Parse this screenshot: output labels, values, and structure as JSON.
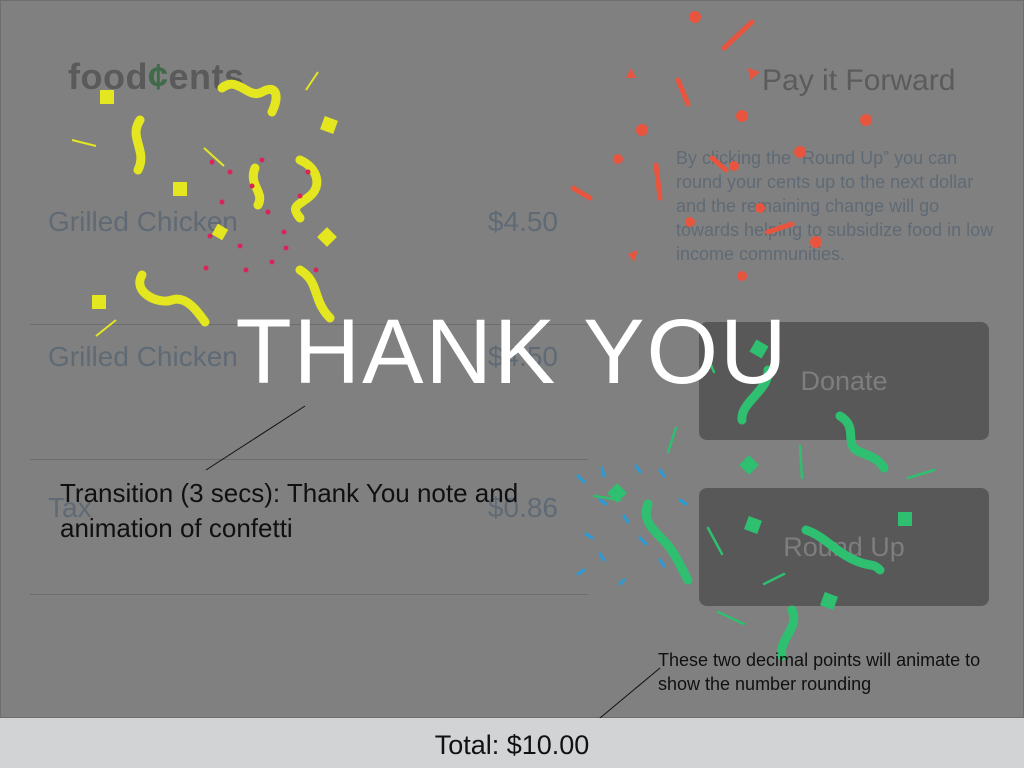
{
  "app": {
    "logo_prefix": "food",
    "logo_cent": "¢",
    "logo_suffix": "ents"
  },
  "order": {
    "items": [
      {
        "name": "Grilled Chicken",
        "price": "$4.50"
      },
      {
        "name": "Grilled Chicken",
        "price": "$4.50"
      }
    ],
    "tax": {
      "name": "Tax",
      "price": "$0.86"
    }
  },
  "pay_forward": {
    "title": "Pay it Forward",
    "description": "By clicking the “Round Up” you can round your cents up to the next dollar and the remaining change will go towards helping to subsidize food in low income communities.",
    "donate_label": "Donate",
    "roundup_label": "Round Up"
  },
  "overlay": {
    "thank_you": "THANK YOU"
  },
  "annotations": {
    "transition_note": "Transition (3 secs): Thank You note and animation of confetti",
    "decimal_note": "These two decimal points will animate to show the number rounding"
  },
  "footer": {
    "total_label": "Total: $10.00"
  },
  "colors": {
    "background": "#808080",
    "button": "#585858",
    "total_bar": "#d1d3d4",
    "confetti_yellow": "#e4e620",
    "confetti_red": "#e8553f",
    "confetti_pink": "#d9245a",
    "confetti_green": "#2fbf71",
    "confetti_blue": "#2a9bd6"
  }
}
